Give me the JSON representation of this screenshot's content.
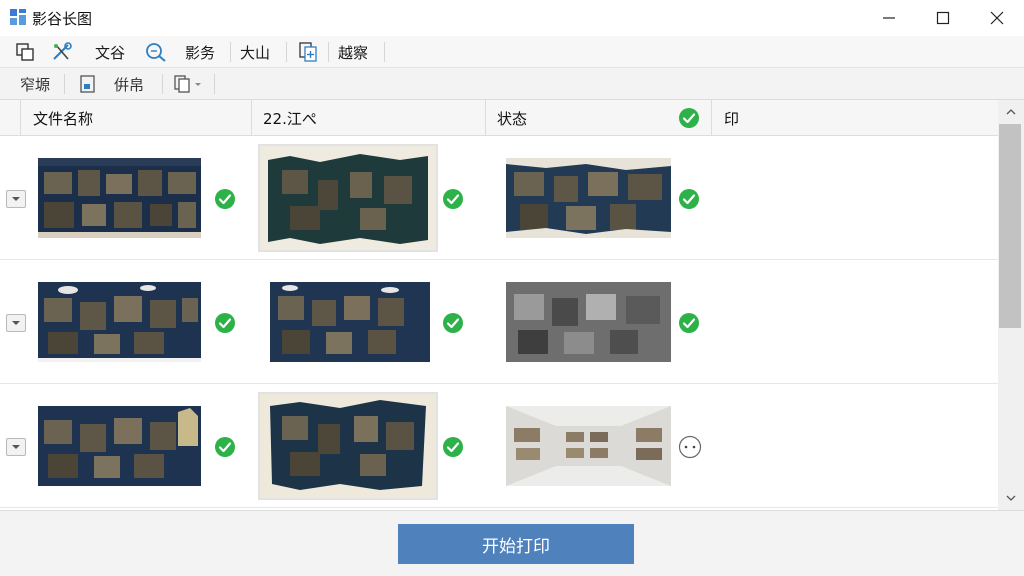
{
  "window": {
    "title": "影谷长图",
    "controls": [
      "minimize",
      "maximize",
      "close"
    ]
  },
  "toolbar1": {
    "items": [
      {
        "icon": "layers-icon"
      },
      {
        "icon": "tools-icon"
      },
      {
        "label": "文谷"
      },
      {
        "icon": "search-icon"
      },
      {
        "label": "影务"
      },
      {
        "label": "大山"
      },
      {
        "icon": "add-file-icon"
      },
      {
        "label": "越察"
      }
    ]
  },
  "toolbar2": {
    "items": [
      {
        "label": "窄塬"
      },
      {
        "icon": "export-icon"
      },
      {
        "label": "倂帛"
      },
      {
        "icon": "copy-icon",
        "dropdown": true
      }
    ]
  },
  "columns": {
    "filename": "文件名称",
    "size": "22.江ぺ",
    "status": "状态",
    "print": "印"
  },
  "rows": [
    {
      "c1": "done",
      "c2": "done",
      "c3": "done",
      "c3_style": "dark"
    },
    {
      "c1": "done",
      "c2": "done",
      "c3": "done",
      "c3_style": "mono"
    },
    {
      "c1": "done",
      "c2": "done",
      "c3": "pending",
      "c3_style": "light"
    }
  ],
  "footer": {
    "print_button": "开始打印"
  },
  "colors": {
    "accent": "#4f81bd",
    "success": "#2db24a"
  }
}
